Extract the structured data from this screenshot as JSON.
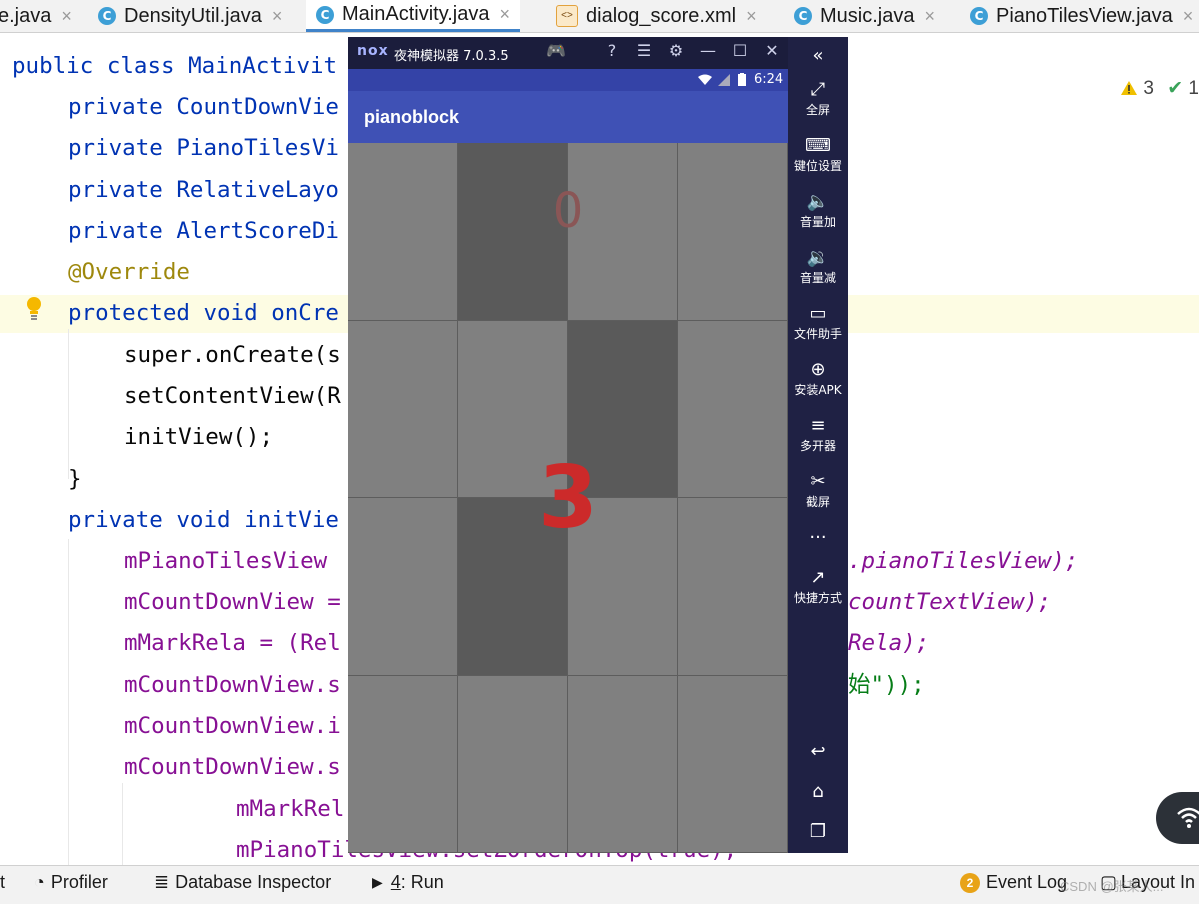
{
  "tabs": [
    {
      "label": "e.java",
      "icon": "none",
      "active": false
    },
    {
      "label": "DensityUtil.java",
      "icon": "class-icon",
      "active": false
    },
    {
      "label": "MainActivity.java",
      "icon": "class-icon",
      "active": true
    },
    {
      "label": "dialog_score.xml",
      "icon": "xml-icon",
      "active": false
    },
    {
      "label": "Music.java",
      "icon": "class-icon",
      "active": false
    },
    {
      "label": "PianoTilesView.java",
      "icon": "class-icon",
      "active": false
    }
  ],
  "class_glyph": "C",
  "close_glyph": "×",
  "xml_glyph": "<>",
  "editor": {
    "warnings": {
      "warn_count": "3",
      "ok_count": "1"
    },
    "lines": {
      "l1": "public class MainActivit",
      "l2": "private CountDownVie",
      "l3": "private PianoTilesVi",
      "l4": "private RelativeLayo",
      "l5": "private AlertScoreDi",
      "l6": "@Override",
      "l7": "protected void onCre",
      "l8": "super.onCreate(s",
      "l9": "setContentView(R",
      "l10": "initView();",
      "l11": "}",
      "l12": "private void initVie",
      "l13a": "mPianoTilesView",
      "l13b": ".pianoTilesView);",
      "l14a": "mCountDownView =",
      "l14b": "countTextView);",
      "l15a": "mMarkRela = (Rel",
      "l15b": "Rela);",
      "l16a": "mCountDownView.s",
      "l16b": "始\"));",
      "l17": "mCountDownView.i",
      "l18": "mCountDownView.s",
      "l19": "mMarkRel",
      "l20": "mPianoTilesView.setZOrderOnTop(true);"
    }
  },
  "emulator": {
    "logo": "nox",
    "title": "夜神模拟器 7.0.3.5",
    "controls": [
      "🎮",
      "?",
      "☰",
      "⚙",
      "—",
      "☐",
      "✕"
    ],
    "status_time": "6:24",
    "app_title": "pianoblock",
    "score": "0",
    "countdown": "3",
    "tiles_dark": [
      [
        1
      ],
      [
        2
      ],
      [
        1
      ],
      []
    ],
    "colors": {
      "tile_light": "#808080",
      "tile_dark": "#5a5a5a",
      "countdown": "#cc2a2a",
      "appbar": "#3f51b5"
    },
    "sidebar": [
      {
        "icon": "collapse-icon",
        "glyph": "«",
        "label": ""
      },
      {
        "icon": "fullscreen-icon",
        "glyph": "⤢",
        "label": "全屏"
      },
      {
        "icon": "keymap-icon",
        "glyph": "⌨",
        "label": "键位设置"
      },
      {
        "icon": "volume-up-icon",
        "glyph": "🔈",
        "label": "音量加"
      },
      {
        "icon": "volume-down-icon",
        "glyph": "🔉",
        "label": "音量减"
      },
      {
        "icon": "file-helper-icon",
        "glyph": "▭",
        "label": "文件助手"
      },
      {
        "icon": "install-apk-icon",
        "glyph": "⊕",
        "label": "安装APK"
      },
      {
        "icon": "multi-instance-icon",
        "glyph": "≡",
        "label": "多开器"
      },
      {
        "icon": "screenshot-icon",
        "glyph": "✂",
        "label": "截屏"
      },
      {
        "icon": "more-icon",
        "glyph": "···",
        "label": ""
      },
      {
        "icon": "shortcut-icon",
        "glyph": "↗",
        "label": "快捷方式"
      },
      {
        "icon": "back-icon",
        "glyph": "↩",
        "label": ""
      },
      {
        "icon": "home-icon",
        "glyph": "⌂",
        "label": ""
      },
      {
        "icon": "recents-icon",
        "glyph": "❐",
        "label": ""
      }
    ]
  },
  "bottombar": {
    "profiler": "Profiler",
    "db_inspector": "Database Inspector",
    "run_num": "4",
    "run_label": ": Run",
    "event_count": "2",
    "event_log": "Event Log",
    "layout": "Layout In",
    "left_cut": "t"
  },
  "watermark": "CSDN @张某人..."
}
